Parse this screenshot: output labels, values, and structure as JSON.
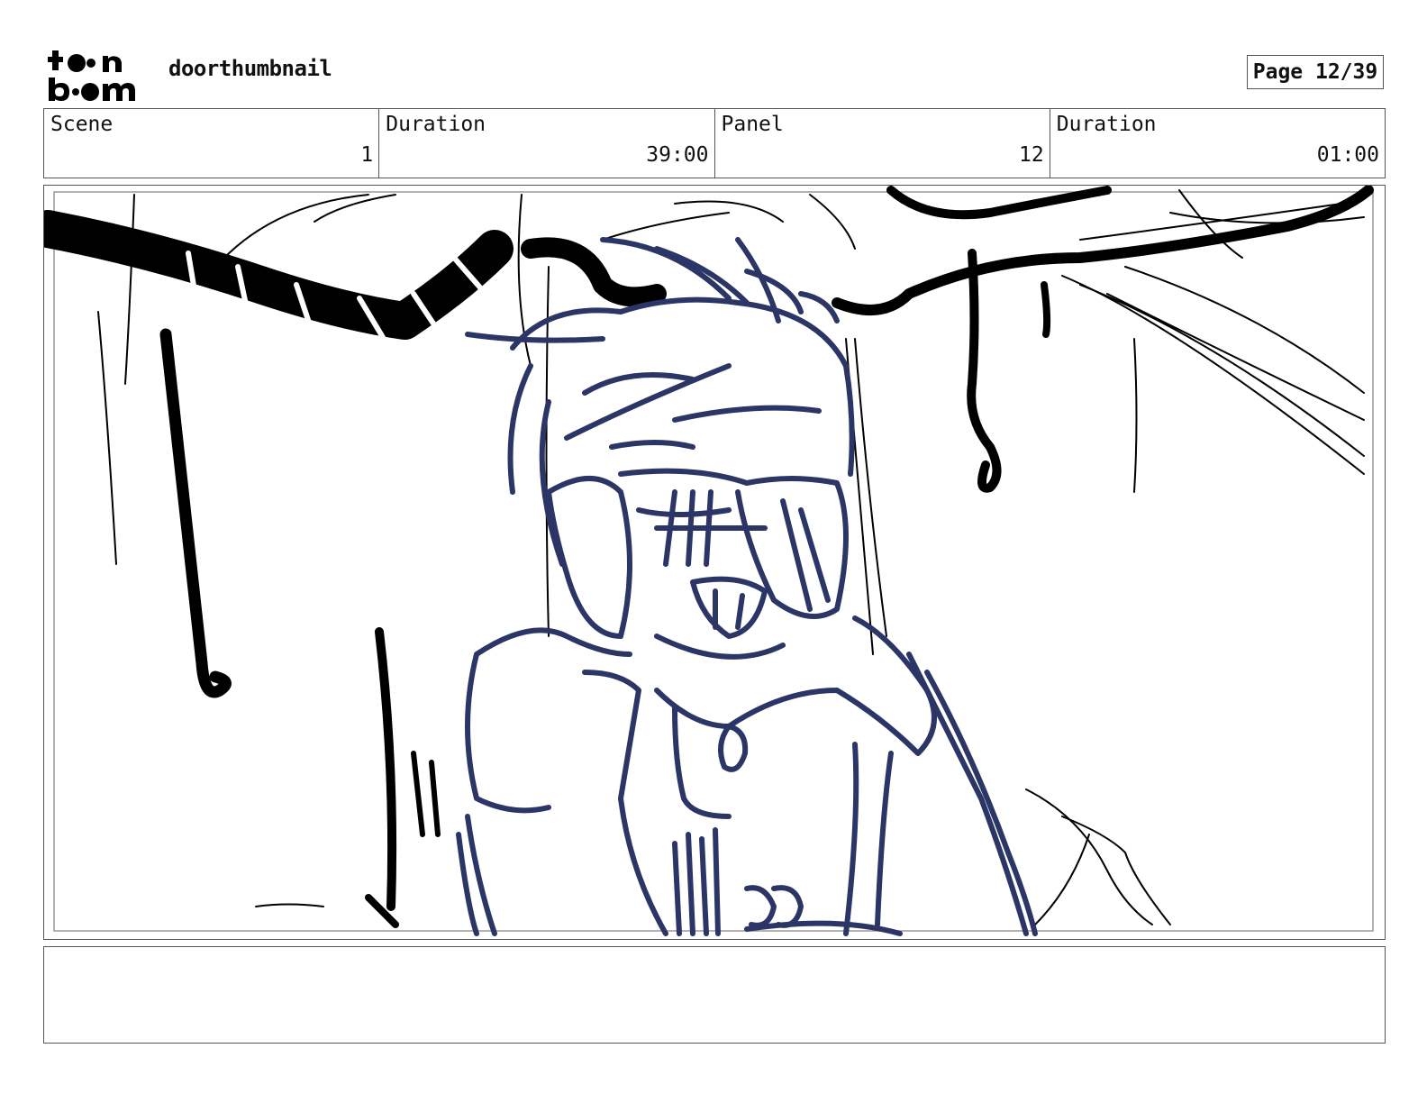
{
  "header": {
    "logo_text": "toon boom",
    "title": "doorthumbnail",
    "page_label": "Page 12/39"
  },
  "info": {
    "scene_label": "Scene",
    "scene_value": "1",
    "scene_duration_label": "Duration",
    "scene_duration_value": "39:00",
    "panel_label": "Panel",
    "panel_value": "12",
    "panel_duration_label": "Duration",
    "panel_duration_value": "01:00"
  },
  "colors": {
    "ink": "#000000",
    "character_ink": "#2b3566",
    "border": "#555555"
  }
}
